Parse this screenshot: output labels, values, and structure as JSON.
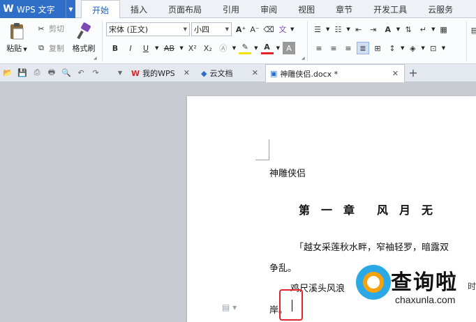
{
  "app": {
    "title": "WPS 文字",
    "logo_letter": "W",
    "accent": "#2f6fc7"
  },
  "menu_tabs": [
    {
      "label": "开始",
      "active": true
    },
    {
      "label": "插入"
    },
    {
      "label": "页面布局"
    },
    {
      "label": "引用"
    },
    {
      "label": "审阅"
    },
    {
      "label": "视图"
    },
    {
      "label": "章节"
    },
    {
      "label": "开发工具"
    },
    {
      "label": "云服务"
    }
  ],
  "ribbon": {
    "paste_label": "粘贴",
    "cut_label": "剪切",
    "copy_label": "复制",
    "format_painter_label": "格式刷",
    "font_name": "宋体 (正文)",
    "font_size": "小四",
    "bold": "B",
    "italic": "I",
    "underline": "U",
    "strike": "AB",
    "superscript": "X²",
    "subscript": "X₂",
    "grow_font": "A⁺",
    "shrink_font": "A⁻",
    "font_color_letter": "A",
    "highlight_color": "#f5e400",
    "font_color": "#e0232b"
  },
  "doc_tabs": [
    {
      "label": "我的WPS",
      "icon": "wps-logo-icon"
    },
    {
      "label": "云文档",
      "icon": "cloud-doc-icon"
    },
    {
      "label": "神雕侠侣.docx *",
      "icon": "docx-file-icon",
      "active": true
    }
  ],
  "document": {
    "line1": "神雕侠侣",
    "chapter": "第　一　章　　风　月　无",
    "para1": "「越女采莲秋水畔，窄袖轻罗，暗露双",
    "para1_cont": "争乱。",
    "para2": "鸡尺溪头风浪",
    "para3": "岸。"
  },
  "watermark": {
    "brand": "查询啦",
    "brand_tail": "时",
    "domain": "chaxunla.com"
  }
}
